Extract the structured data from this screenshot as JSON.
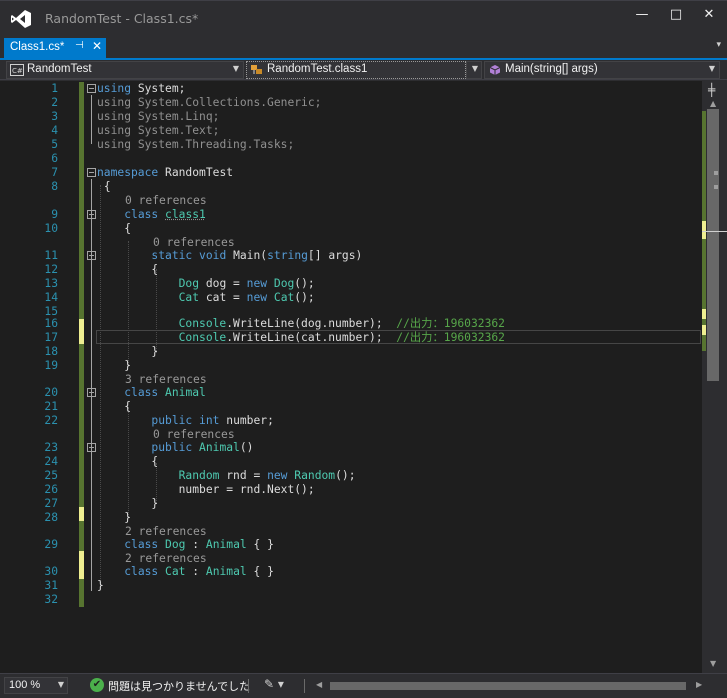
{
  "window": {
    "title": "RandomTest - Class1.cs*",
    "minimize": "—",
    "maximize": "□",
    "close": "✕"
  },
  "tab": {
    "label": "Class1.cs*",
    "pin": "⊣",
    "close": "✕",
    "overflow": "▾"
  },
  "nav": {
    "project": "RandomTest",
    "class": "RandomTest.class1",
    "member": "Main(string[] args)"
  },
  "lines": {
    "l1": "1",
    "l2": "2",
    "l3": "3",
    "l4": "4",
    "l5": "5",
    "l6": "6",
    "l7": "7",
    "l8": "8",
    "l9": "9",
    "l10": "10",
    "l11": "11",
    "l12": "12",
    "l13": "13",
    "l14": "14",
    "l15": "15",
    "l16": "16",
    "l17": "17",
    "l18": "18",
    "l19": "19",
    "l20": "20",
    "l21": "21",
    "l22": "22",
    "l23": "23",
    "l24": "24",
    "l25": "25",
    "l26": "26",
    "l27": "27",
    "l28": "28",
    "l29": "29",
    "l30": "30",
    "l31": "31",
    "l32": "32"
  },
  "code": {
    "using": "using",
    "ns1": "System;",
    "ns2": "System.Collections.Generic;",
    "ns3": "System.Linq;",
    "ns4": "System.Text;",
    "ns5": "System.Threading.Tasks;",
    "namespace_kw": "namespace",
    "namespace_name": "RandomTest",
    "open_brace": "{",
    "close_brace": "}",
    "class_kw": "class",
    "class1_name": "class1",
    "static_kw": "static",
    "void_kw": "void",
    "main_name": "Main",
    "string_kw": "string",
    "args_text": "[] args)",
    "paren_open": "(",
    "dog_type": "Dog",
    "dog_decl": "dog =",
    "new_kw": "new",
    "ctor_end": "();",
    "cat_type": "Cat",
    "cat_decl": "cat =",
    "console": "Console",
    "writeline": ".WriteLine(dog.number);",
    "writeline2": ".WriteLine(cat.number);",
    "comment": "//出力：196032362",
    "animal_name": "Animal",
    "public_kw": "public",
    "int_kw": "int",
    "number_field": "number;",
    "ctor_parens": "()",
    "random_type": "Random",
    "rnd_decl": "rnd =",
    "assign_next": "number = rnd.Next();",
    "colon": ":",
    "empty_body": "{ }"
  },
  "codelens": {
    "zero_refs": "0 references",
    "three_refs": "3 references",
    "two_refs": "2 references"
  },
  "status": {
    "zoom": "100 %",
    "issues_text": "問題は見つかりませんでした",
    "check": "✔"
  },
  "colors": {
    "accent": "#007acc",
    "keyword": "#569cd6",
    "type": "#4ec9b0",
    "comment": "#57a64a",
    "line_number": "#2b91af",
    "change_saved": "#577430",
    "change_unsaved": "#efef91"
  }
}
